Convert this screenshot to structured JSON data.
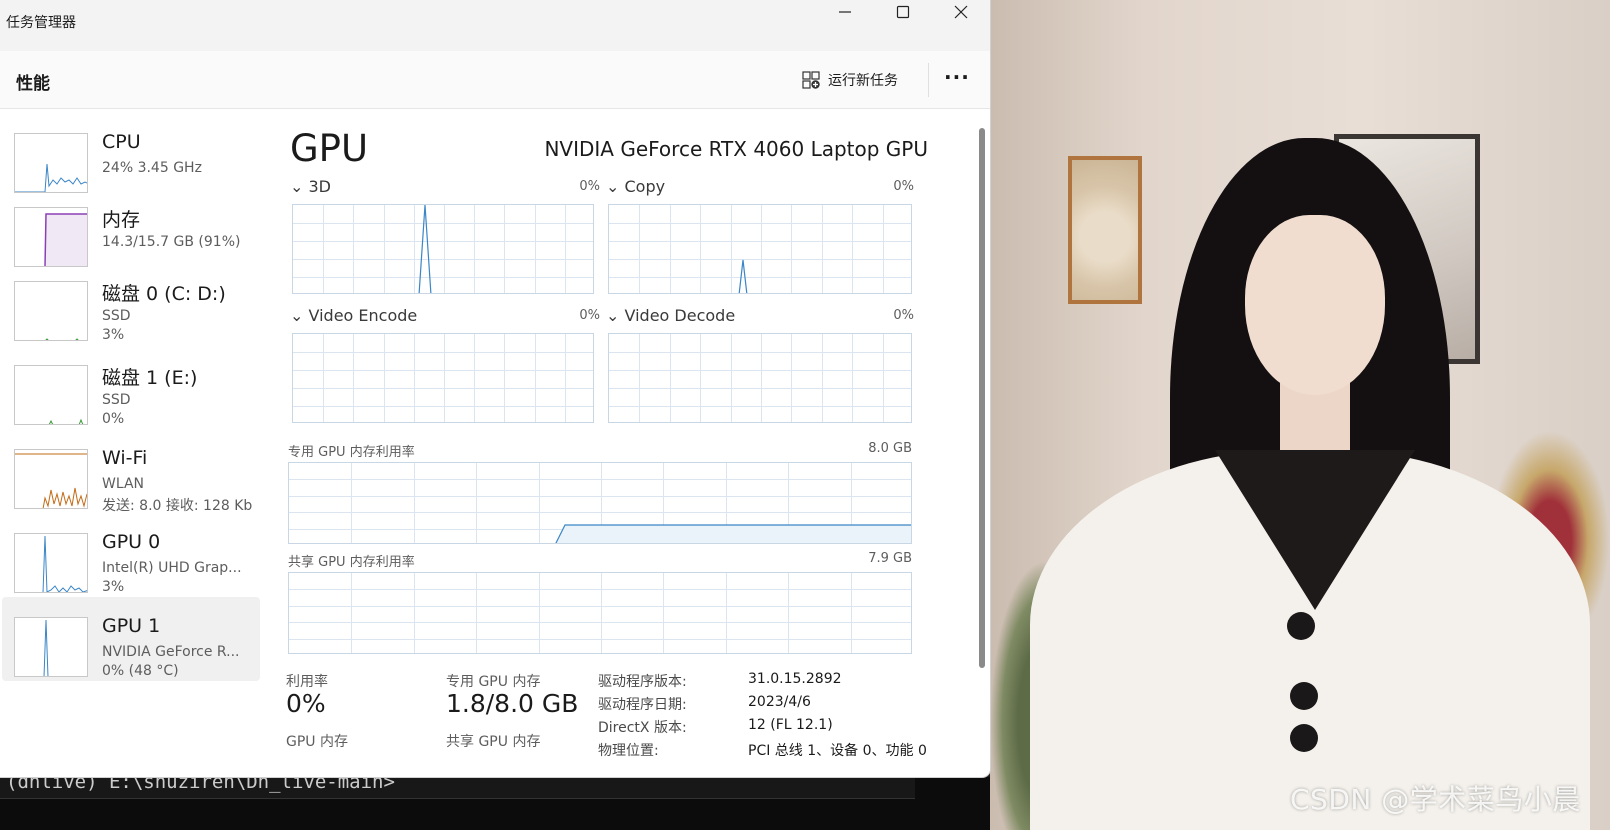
{
  "window": {
    "title": "任务管理器",
    "header": "性能",
    "run_task_label": "运行新任务",
    "more_label": "···",
    "min_label": "—",
    "max_label": "☐",
    "close_label": "✕"
  },
  "sidebar": {
    "items": [
      {
        "name": "CPU",
        "sub1": "24%  3.45 GHz",
        "sub2": ""
      },
      {
        "name": "内存",
        "sub1": "14.3/15.7 GB (91%)",
        "sub2": ""
      },
      {
        "name": "磁盘 0 (C: D:)",
        "sub1": "SSD",
        "sub2": "3%"
      },
      {
        "name": "磁盘 1 (E:)",
        "sub1": "SSD",
        "sub2": "0%"
      },
      {
        "name": "Wi-Fi",
        "sub1": "WLAN",
        "sub2": "发送: 8.0  接收: 128 Kb"
      },
      {
        "name": "GPU 0",
        "sub1": "Intel(R) UHD Grap...",
        "sub2": "3%"
      },
      {
        "name": "GPU 1",
        "sub1": "NVIDIA GeForce R...",
        "sub2": "0% (48 °C)"
      }
    ],
    "selected_index": 6
  },
  "main": {
    "title": "GPU",
    "model": "NVIDIA GeForce RTX 4060 Laptop GPU",
    "engines": [
      {
        "label": "3D",
        "percent": "0%"
      },
      {
        "label": "Copy",
        "percent": "0%"
      },
      {
        "label": "Video Encode",
        "percent": "0%"
      },
      {
        "label": "Video Decode",
        "percent": "0%"
      }
    ],
    "dedicated_memory_graph": {
      "label": "专用 GPU 内存利用率",
      "max": "8.0 GB"
    },
    "shared_memory_graph": {
      "label": "共享 GPU 内存利用率",
      "max": "7.9 GB"
    },
    "stats": {
      "utilization_label": "利用率",
      "utilization_value": "0%",
      "dedicated_label": "专用 GPU 内存",
      "dedicated_value": "1.8/8.0 GB",
      "gpu_memory_label": "GPU 内存",
      "shared_label": "共享 GPU 内存"
    },
    "properties": [
      {
        "key": "驱动程序版本:",
        "value": "31.0.15.2892"
      },
      {
        "key": "驱动程序日期:",
        "value": "2023/4/6"
      },
      {
        "key": "DirectX 版本:",
        "value": "12 (FL 12.1)"
      },
      {
        "key": "物理位置:",
        "value": "PCI 总线 1、设备 0、功能 0"
      }
    ]
  },
  "terminal": {
    "line": "(dhlive) E:\\shuziren\\Dh_live-main>"
  },
  "watermark": "CSDN @学术菜鸟小晨",
  "colors": {
    "graph_line": "#3a86c7",
    "memory_line": "#8b3fb5",
    "disk_line": "#3a9a3a",
    "wifi_line": "#c36b16",
    "grid": "#dbe5ef"
  }
}
